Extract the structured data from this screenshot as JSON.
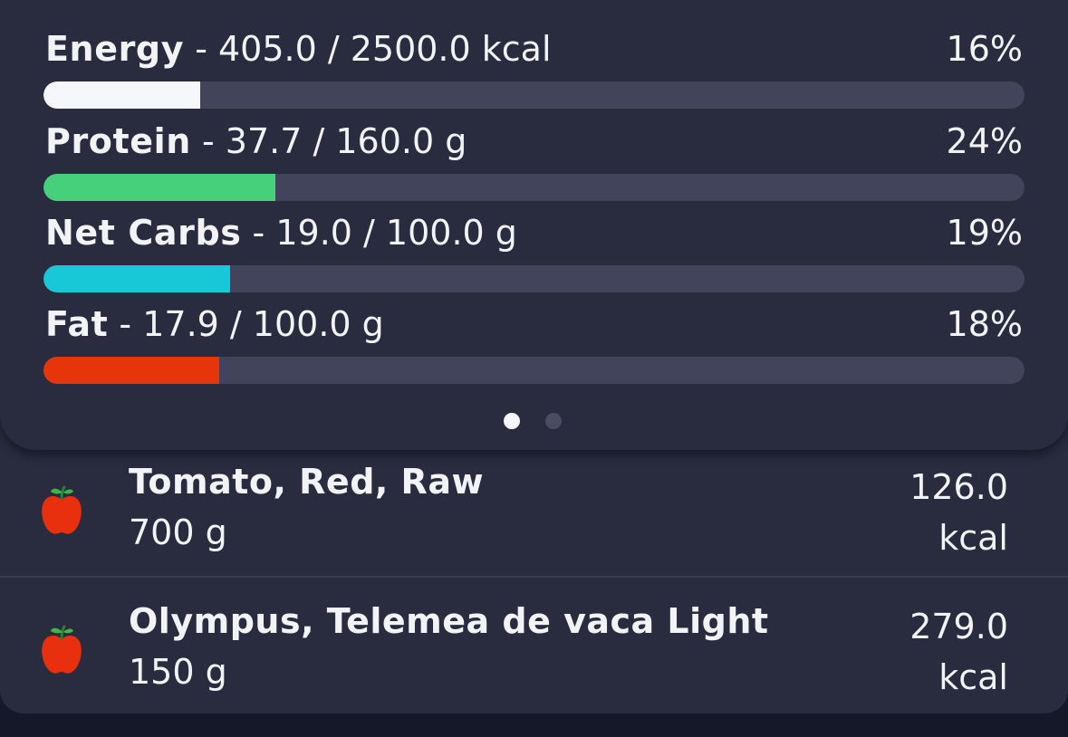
{
  "colors": {
    "energy": "#f6f7fc",
    "protein": "#46d07c",
    "net_carbs": "#19c8d7",
    "fat": "#e6340b"
  },
  "macros": [
    {
      "name": "Energy",
      "detail": " - 405.0 / 2500.0 kcal",
      "percent_text": "16%",
      "progress": 0.16,
      "color": "#f6f7fc"
    },
    {
      "name": "Protein",
      "detail": " - 37.7 / 160.0 g",
      "percent_text": "24%",
      "progress": 0.236,
      "color": "#46d07c"
    },
    {
      "name": "Net Carbs",
      "detail": " - 19.0 / 100.0 g",
      "percent_text": "19%",
      "progress": 0.19,
      "color": "#19c8d7"
    },
    {
      "name": "Fat",
      "detail": " - 17.9 / 100.0 g",
      "percent_text": "18%",
      "progress": 0.179,
      "color": "#e6340b"
    }
  ],
  "pager": {
    "page_count": 2,
    "active_page": 1
  },
  "foods": [
    {
      "icon": "apple-icon",
      "name": "Tomato, Red, Raw",
      "amount": "700 g",
      "energy_value": "126.0",
      "energy_unit": "kcal"
    },
    {
      "icon": "apple-icon",
      "name": "Olympus, Telemea de vaca Light",
      "amount": "150 g",
      "energy_value": "279.0",
      "energy_unit": "kcal"
    }
  ]
}
